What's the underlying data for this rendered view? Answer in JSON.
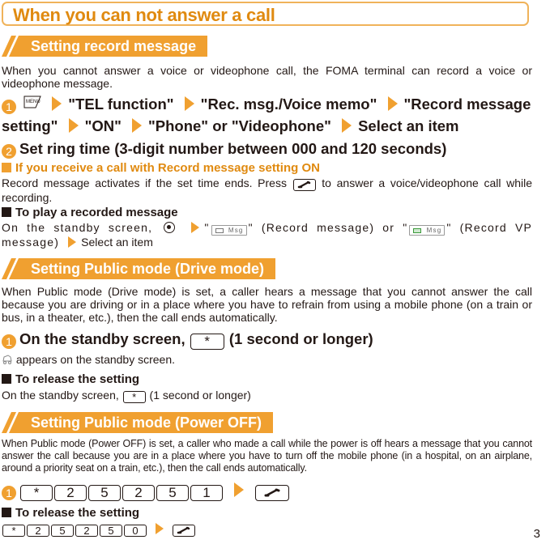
{
  "page": {
    "title": "When you can not answer a call",
    "page_number": "3"
  },
  "sections": {
    "record": {
      "heading": "Setting record message",
      "intro": "When you cannot answer a voice or videophone call, the FOMA terminal can record a voice or videophone message.",
      "step1": {
        "number": "1",
        "menu_key": "MENU",
        "items": [
          "\"TEL function\"",
          "\"Rec. msg./Voice memo\"",
          "\"Record message setting\"",
          "\"ON\"",
          "\"Phone\" or \"Videophone\"",
          "Select an item"
        ]
      },
      "step2": {
        "number": "2",
        "text": "Set ring time (3-digit number between 000 and 120 seconds)"
      },
      "note1": {
        "heading": "If you receive a call with Record message setting ON",
        "text_before": "Record message activates if the set time ends. Press",
        "text_after": "to answer a voice/videophone call while recording."
      },
      "note2": {
        "heading": "To play a recorded message",
        "text_prefix": "On the standby screen,",
        "option1_quote_open": "\"",
        "option1_icon_label": "Msg",
        "option1_text": "\" (Record message) or \"",
        "option2_icon_label": "Msg",
        "option2_text": "\" (Record VP message)",
        "final": "Select an item"
      }
    },
    "drive": {
      "heading": "Setting Public mode (Drive mode)",
      "intro": "When Public mode (Drive mode) is set, a caller hears a message that you cannot answer the call because you are driving or in a place where you have to refrain from using a mobile phone (on a train or bus, in a theater, etc.), then the call ends automatically.",
      "step1": {
        "number": "1",
        "text_before": "On the standby screen,",
        "key": "*",
        "text_after": "(1 second or longer)"
      },
      "appears_text": "appears on the standby screen.",
      "release": {
        "heading": "To release the setting",
        "text_before": "On the standby screen,",
        "key": "*",
        "text_after": "(1 second or longer)"
      }
    },
    "power": {
      "heading": "Setting Public mode (Power OFF)",
      "intro": "When Public mode (Power OFF) is set, a caller who made a call while the power is off hears a message that you cannot answer the call because you are in a place where you have to turn off the mobile phone (in a hospital, on an airplane, around a priority seat on a train, etc.), then the call ends automatically.",
      "step1": {
        "number": "1",
        "keys": [
          "*",
          "2",
          "5",
          "2",
          "5",
          "1"
        ]
      },
      "release": {
        "heading": "To release the setting",
        "keys": [
          "*",
          "2",
          "5",
          "2",
          "5",
          "0"
        ]
      }
    }
  },
  "colors": {
    "accent": "#f0a030",
    "title_text": "#e08a10",
    "title_border": "#f0b35a",
    "body_text": "#231815"
  }
}
